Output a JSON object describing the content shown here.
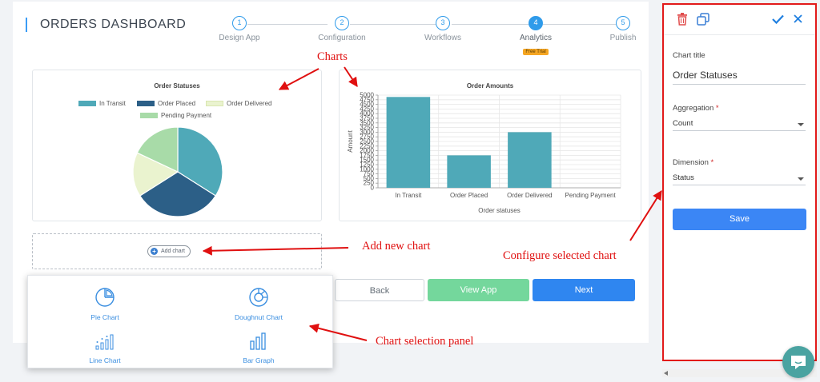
{
  "header": {
    "title": "ORDERS DASHBOARD"
  },
  "steps": [
    {
      "number": "1",
      "label": "Design App",
      "active": false
    },
    {
      "number": "2",
      "label": "Configuration",
      "active": false
    },
    {
      "number": "3",
      "label": "Workflows",
      "active": false
    },
    {
      "number": "4",
      "label": "Analytics",
      "active": true,
      "badge": "Free Trial"
    },
    {
      "number": "5",
      "label": "Publish",
      "active": false
    }
  ],
  "pie_chart": {
    "title": "Order Statuses",
    "legend": [
      "In Transit",
      "Order Placed",
      "Order Delivered",
      "Pending Payment"
    ]
  },
  "bar_chart": {
    "title": "Order Amounts",
    "xlabel": "Order statuses",
    "ylabel": "Amount"
  },
  "chart_data": [
    {
      "type": "pie",
      "title": "Order Statuses",
      "categories": [
        "In Transit",
        "Order Placed",
        "Order Delivered",
        "Pending Payment"
      ],
      "values": [
        34,
        32,
        16,
        18
      ],
      "colors": [
        "#4fa9b8",
        "#2c5f87",
        "#eaf3cf",
        "#a8dba8"
      ],
      "legend": "top"
    },
    {
      "type": "bar",
      "title": "Order Amounts",
      "categories": [
        "In Transit",
        "Order Placed",
        "Order Delivered",
        "Pending Payment"
      ],
      "values": [
        4900,
        1750,
        3000,
        0
      ],
      "xlabel": "Order statuses",
      "ylabel": "Amount",
      "ylim": [
        0,
        5000
      ],
      "yticks": [
        "0",
        "250",
        "500",
        "750",
        "1000",
        "1250",
        "1500",
        "1750",
        "2000",
        "2250",
        "2500",
        "2750",
        "3000",
        "3250",
        "3500",
        "3750",
        "4000",
        "4250",
        "4500",
        "4750",
        "5000"
      ],
      "grid": true,
      "color": "#4fa9b8"
    }
  ],
  "add_chart": {
    "label": "Add chart"
  },
  "nav_buttons": {
    "back": "Back",
    "view_app": "View App",
    "next": "Next"
  },
  "chart_options": [
    {
      "label": "Pie Chart",
      "icon": "pie-chart-icon"
    },
    {
      "label": "Doughnut Chart",
      "icon": "doughnut-chart-icon"
    },
    {
      "label": "Line Chart",
      "icon": "line-chart-icon"
    },
    {
      "label": "Bar Graph",
      "icon": "bar-graph-icon"
    }
  ],
  "annotations": {
    "charts": "Charts",
    "add_new_chart": "Add new chart",
    "configure_selected_chart": "Configure selected chart",
    "chart_selection_panel": "Chart selection panel"
  },
  "config_panel": {
    "chart_title_label": "Chart title",
    "chart_title_value": "Order Statuses",
    "aggregation_label": "Aggregation",
    "aggregation_value": "Count",
    "dimension_label": "Dimension",
    "dimension_value": "Status",
    "save_label": "Save",
    "required_mark": "*"
  },
  "colors": {
    "accent": "#2f9bea",
    "annotation": "#e01010",
    "next": "#2f86f0",
    "view_app": "#74d79c",
    "delete_icon": "#e14c4c"
  }
}
